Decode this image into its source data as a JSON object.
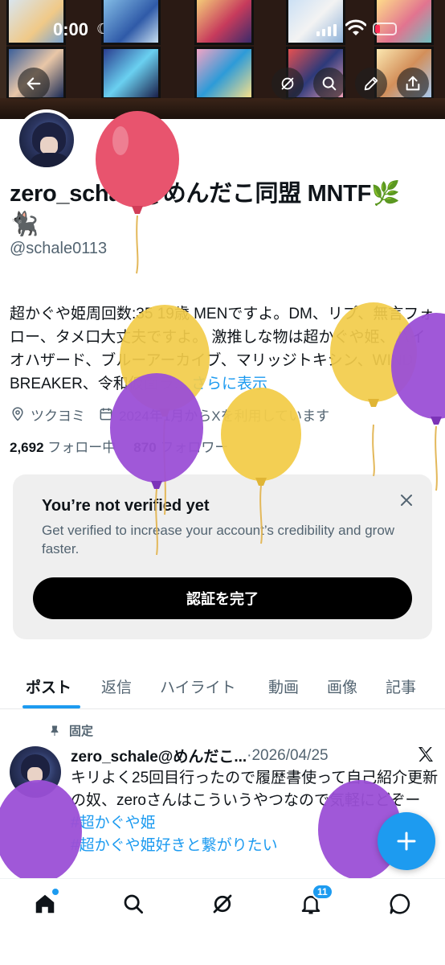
{
  "status_bar": {
    "time": "0:00",
    "moon_icon": "moon-icon",
    "battery_level": 0.25
  },
  "header": {
    "back_icon": "back-arrow-icon",
    "grok_icon": "grok-icon",
    "search_icon": "search-icon",
    "edit_icon": "pencil-icon",
    "share_icon": "share-icon"
  },
  "profile": {
    "display_name": "zero_schale@めんだこ同盟 MNTF🌿🐈‍⬛",
    "handle": "@schale0113",
    "bio": "超かぐや姫周回数:35 19歳 MENですよ。DM、リプ、無言フォロー、タメ口大丈夫ですよ。 激推しな物は超かぐや姫、バイオハザード、ブルーアーカイブ、マリッジトキシン、WIND BREAKER、令和仮面ラ...",
    "bio_more": "さらに表示",
    "location": "ツクヨミ",
    "joined": "2024年1月からXを利用しています",
    "following_count": "2,692",
    "following_label": "フォロー中",
    "followers_count": "870",
    "followers_label": "フォロワー"
  },
  "verify_card": {
    "title": "You’re not verified yet",
    "description": "Get verified to increase your account’s credibility and grow faster.",
    "button": "認証を完了"
  },
  "tabs": [
    "ポスト",
    "返信",
    "ハイライト",
    "動画",
    "画像",
    "記事"
  ],
  "post": {
    "pinned_label": "固定",
    "author": "zero_schale@めんだこ...",
    "separator": "·",
    "date": "2026/04/25",
    "text": "キリよく25回目行ったので履歴書使って自己紹介更新の奴、zeroさんはこういうやつなので気軽にどぞー",
    "hashtags": [
      "#超かぐや姫",
      "#超かぐや姫好きと繋がりたい"
    ]
  },
  "nav": {
    "items": [
      "home-icon",
      "search-icon",
      "grok-icon",
      "bell-icon",
      "chat-icon"
    ],
    "notification_badge": "11"
  },
  "colors": {
    "accent": "#1d9bf0",
    "text": "#0f1419",
    "muted": "#536471",
    "balloon_red": "#e8546e",
    "balloon_yellow": "#f2cc4a",
    "balloon_purple": "#9b4fd6"
  }
}
